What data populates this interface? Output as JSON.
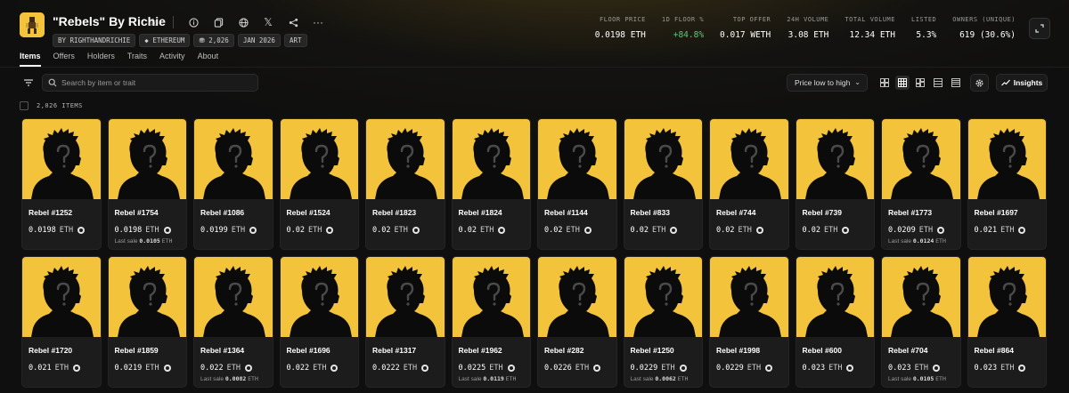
{
  "collection": {
    "title": "\"Rebels\" By Richie",
    "chips": [
      "BY RIGHTHANDRICHIE",
      "ETHEREUM",
      "2,026",
      "JAN 2026",
      "ART"
    ]
  },
  "stats": [
    {
      "label": "FLOOR PRICE",
      "value": "0.0198 ETH"
    },
    {
      "label": "1D FLOOR %",
      "value": "+84.8%"
    },
    {
      "label": "TOP OFFER",
      "value": "0.017 WETH"
    },
    {
      "label": "24H VOLUME",
      "value": "3.08 ETH"
    },
    {
      "label": "TOTAL VOLUME",
      "value": "12.34 ETH"
    },
    {
      "label": "LISTED",
      "value": "5.3%"
    },
    {
      "label": "OWNERS (UNIQUE)",
      "value": "619 (30.6%)"
    }
  ],
  "tabs": [
    "Items",
    "Offers",
    "Holders",
    "Traits",
    "Activity",
    "About"
  ],
  "toolbar": {
    "search_placeholder": "Search by item or trait",
    "sort_label": "Price low to high",
    "insights_label": "Insights"
  },
  "items_count": "2,026 ITEMS",
  "colors": {
    "accent_yellow": "#f3c33b",
    "positive": "#4fd07a",
    "bg": "#0f0f0f"
  },
  "items": [
    {
      "name": "Rebel #1252",
      "price": "0.0198",
      "unit": "ETH",
      "last_label": "",
      "last_value": "",
      "last_unit": ""
    },
    {
      "name": "Rebel #1754",
      "price": "0.0198",
      "unit": "ETH",
      "last_label": "Last sale",
      "last_value": "0.0105",
      "last_unit": "ETH"
    },
    {
      "name": "Rebel #1086",
      "price": "0.0199",
      "unit": "ETH",
      "last_label": "",
      "last_value": "",
      "last_unit": ""
    },
    {
      "name": "Rebel #1524",
      "price": "0.02",
      "unit": "ETH",
      "last_label": "",
      "last_value": "",
      "last_unit": ""
    },
    {
      "name": "Rebel #1823",
      "price": "0.02",
      "unit": "ETH",
      "last_label": "",
      "last_value": "",
      "last_unit": ""
    },
    {
      "name": "Rebel #1824",
      "price": "0.02",
      "unit": "ETH",
      "last_label": "",
      "last_value": "",
      "last_unit": ""
    },
    {
      "name": "Rebel #1144",
      "price": "0.02",
      "unit": "ETH",
      "last_label": "",
      "last_value": "",
      "last_unit": ""
    },
    {
      "name": "Rebel #833",
      "price": "0.02",
      "unit": "ETH",
      "last_label": "",
      "last_value": "",
      "last_unit": ""
    },
    {
      "name": "Rebel #744",
      "price": "0.02",
      "unit": "ETH",
      "last_label": "",
      "last_value": "",
      "last_unit": ""
    },
    {
      "name": "Rebel #739",
      "price": "0.02",
      "unit": "ETH",
      "last_label": "",
      "last_value": "",
      "last_unit": ""
    },
    {
      "name": "Rebel #1773",
      "price": "0.0209",
      "unit": "ETH",
      "last_label": "Last sale",
      "last_value": "0.0124",
      "last_unit": "ETH"
    },
    {
      "name": "Rebel #1697",
      "price": "0.021",
      "unit": "ETH",
      "last_label": "",
      "last_value": "",
      "last_unit": ""
    },
    {
      "name": "Rebel #1720",
      "price": "0.021",
      "unit": "ETH",
      "last_label": "",
      "last_value": "",
      "last_unit": ""
    },
    {
      "name": "Rebel #1859",
      "price": "0.0219",
      "unit": "ETH",
      "last_label": "",
      "last_value": "",
      "last_unit": ""
    },
    {
      "name": "Rebel #1364",
      "price": "0.022",
      "unit": "ETH",
      "last_label": "Last sale",
      "last_value": "0.0082",
      "last_unit": "ETH"
    },
    {
      "name": "Rebel #1696",
      "price": "0.022",
      "unit": "ETH",
      "last_label": "",
      "last_value": "",
      "last_unit": ""
    },
    {
      "name": "Rebel #1317",
      "price": "0.0222",
      "unit": "ETH",
      "last_label": "",
      "last_value": "",
      "last_unit": ""
    },
    {
      "name": "Rebel #1962",
      "price": "0.0225",
      "unit": "ETH",
      "last_label": "Last sale",
      "last_value": "0.0119",
      "last_unit": "ETH"
    },
    {
      "name": "Rebel #282",
      "price": "0.0226",
      "unit": "ETH",
      "last_label": "",
      "last_value": "",
      "last_unit": ""
    },
    {
      "name": "Rebel #1250",
      "price": "0.0229",
      "unit": "ETH",
      "last_label": "Last sale",
      "last_value": "0.0062",
      "last_unit": "ETH"
    },
    {
      "name": "Rebel #1998",
      "price": "0.0229",
      "unit": "ETH",
      "last_label": "",
      "last_value": "",
      "last_unit": ""
    },
    {
      "name": "Rebel #600",
      "price": "0.023",
      "unit": "ETH",
      "last_label": "",
      "last_value": "",
      "last_unit": ""
    },
    {
      "name": "Rebel #704",
      "price": "0.023",
      "unit": "ETH",
      "last_label": "Last sale",
      "last_value": "0.0105",
      "last_unit": "ETH"
    },
    {
      "name": "Rebel #864",
      "price": "0.023",
      "unit": "ETH",
      "last_label": "",
      "last_value": "",
      "last_unit": ""
    }
  ]
}
